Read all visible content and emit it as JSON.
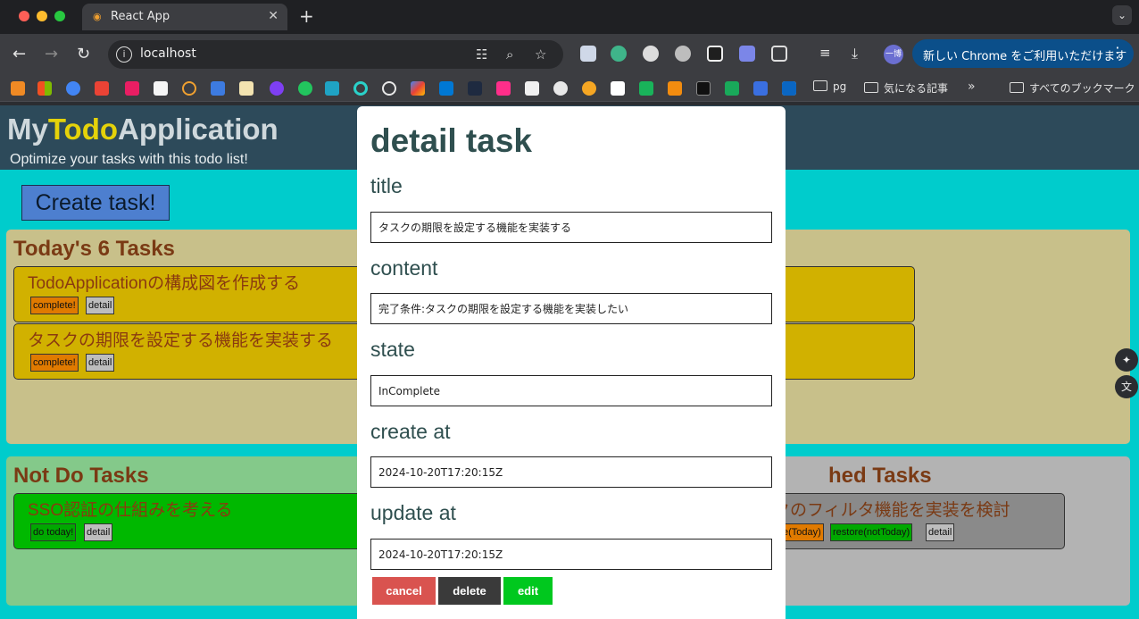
{
  "browser": {
    "tab_title": "React App",
    "url": "localhost",
    "update_button": "新しい Chrome をご利用いただけます",
    "profile_label": "一博",
    "bookmarks": {
      "folder_pg": "pg",
      "folder_articles": "気になる記事",
      "all_bookmarks": "すべてのブックマーク"
    }
  },
  "app": {
    "logo": {
      "prefix": "My",
      "highlight": "Todo",
      "suffix": "Application"
    },
    "subtitle": "Optimize your tasks with this todo list!",
    "create_button": "Create task!"
  },
  "panels": {
    "today": {
      "title": "Today's 6 Tasks",
      "tasks": [
        {
          "title": "TodoApplicationの構成図を作成する",
          "buttons": [
            "complete!",
            "detail"
          ]
        },
        {
          "title": "タスクの期限を設定する機能を実装する",
          "buttons": [
            "complete!",
            "detail"
          ]
        }
      ]
    },
    "notdo": {
      "title": "Not Do Tasks",
      "tasks": [
        {
          "title": "SSO認証の仕組みを考える",
          "buttons": [
            "do today!",
            "detail"
          ]
        }
      ]
    },
    "finished": {
      "title": "hed Tasks",
      "tasks": [
        {
          "title": "クのフィルタ機能を実装を検討",
          "buttons": [
            "e(Today)",
            "restore(notToday)",
            "detail"
          ]
        }
      ]
    }
  },
  "modal": {
    "title": "detail task",
    "fields": [
      {
        "label": "title",
        "value": "タスクの期限を設定する機能を実装する"
      },
      {
        "label": "content",
        "value": "完了条件:タスクの期限を設定する機能を実装したい"
      },
      {
        "label": "state",
        "value": "InComplete"
      },
      {
        "label": "create at",
        "value": "2024-10-20T17:20:15Z"
      },
      {
        "label": "update at",
        "value": "2024-10-20T17:20:15Z"
      }
    ],
    "buttons": {
      "cancel": "cancel",
      "delete": "delete",
      "edit": "edit"
    }
  },
  "colors": {
    "page_bg": "#00cccc",
    "header_bg": "#2d4a5a",
    "logo_highlight": "#e5d20a",
    "today_panel": "#c8c08a",
    "notdo_panel": "#84c98a",
    "finished_panel": "#b3b3b3",
    "task_yellow": "#d1b100",
    "task_green": "#00b800",
    "cancel": "#d9534f",
    "delete": "#3a3a3a",
    "edit": "#00c81e"
  }
}
